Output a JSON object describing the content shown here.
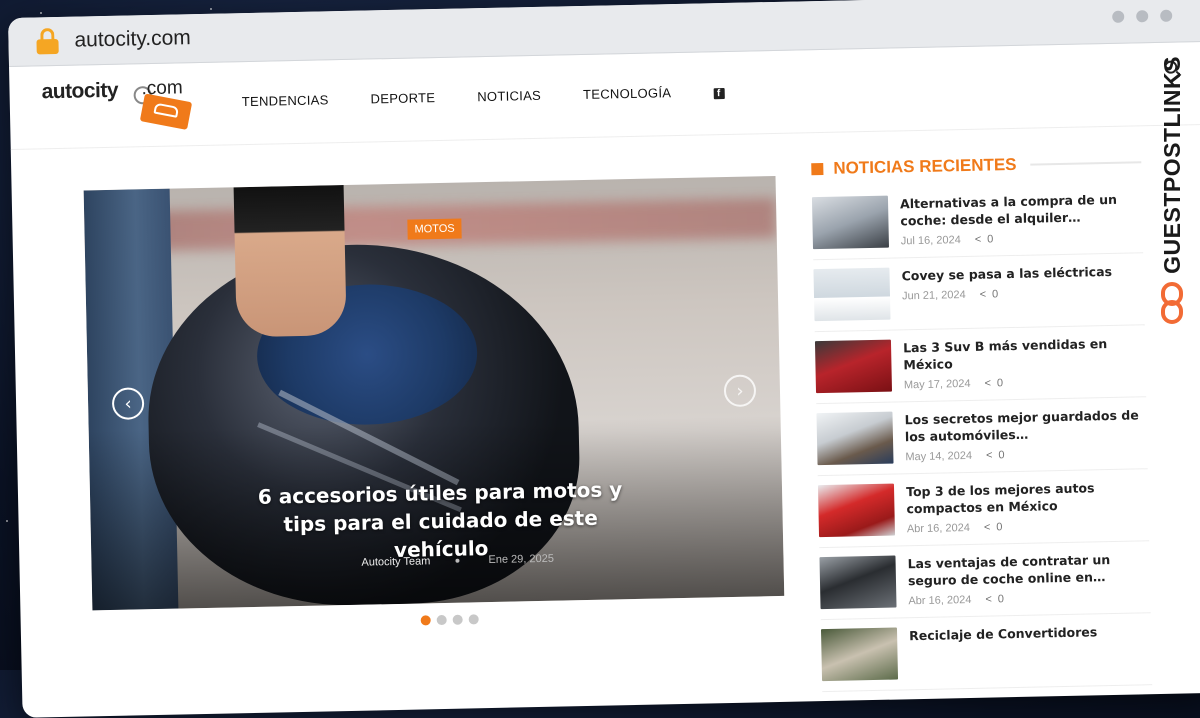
{
  "browser": {
    "url": "autocity.com"
  },
  "site": {
    "logo_word": "autocity",
    "logo_suffix": ".com",
    "nav": [
      {
        "label": "TENDENCIAS"
      },
      {
        "label": "DEPORTE"
      },
      {
        "label": "NOTICIAS"
      },
      {
        "label": "TECNOLOGÍA"
      }
    ],
    "facebook_glyph": "f"
  },
  "hero": {
    "category": "MOTOS",
    "title": "6 accesorios útiles para motos y tips para el cuidado de este vehículo",
    "author": "Autocity Team",
    "date": "Ene 29, 2025",
    "slide_index": 1,
    "slide_count": 4,
    "prev_glyph": "‹",
    "next_glyph": "›"
  },
  "sidebar": {
    "title": "NOTICIAS RECIENTES",
    "items": [
      {
        "title": "Alternativas a la compra de un coche: desde el alquiler…",
        "date": "Jul 16, 2024",
        "shares": "0"
      },
      {
        "title": "Covey se pasa a las eléctricas",
        "date": "Jun 21, 2024",
        "shares": "0"
      },
      {
        "title": "Las 3 Suv B más vendidas en México",
        "date": "May 17, 2024",
        "shares": "0"
      },
      {
        "title": "Los secretos mejor guardados de los automóviles…",
        "date": "May 14, 2024",
        "shares": "0"
      },
      {
        "title": "Top 3 de los mejores autos compactos en México",
        "date": "Abr 16, 2024",
        "shares": "0"
      },
      {
        "title": "Las ventajas de contratar un seguro de coche online en…",
        "date": "Abr 16, 2024",
        "shares": "0"
      },
      {
        "title": "Reciclaje de Convertidores",
        "date": "",
        "shares": ""
      }
    ]
  },
  "watermark": {
    "text": "GUESTPOSTLINKS"
  },
  "colors": {
    "accent": "#f07a1a",
    "watermark_accent": "#f26b35"
  }
}
